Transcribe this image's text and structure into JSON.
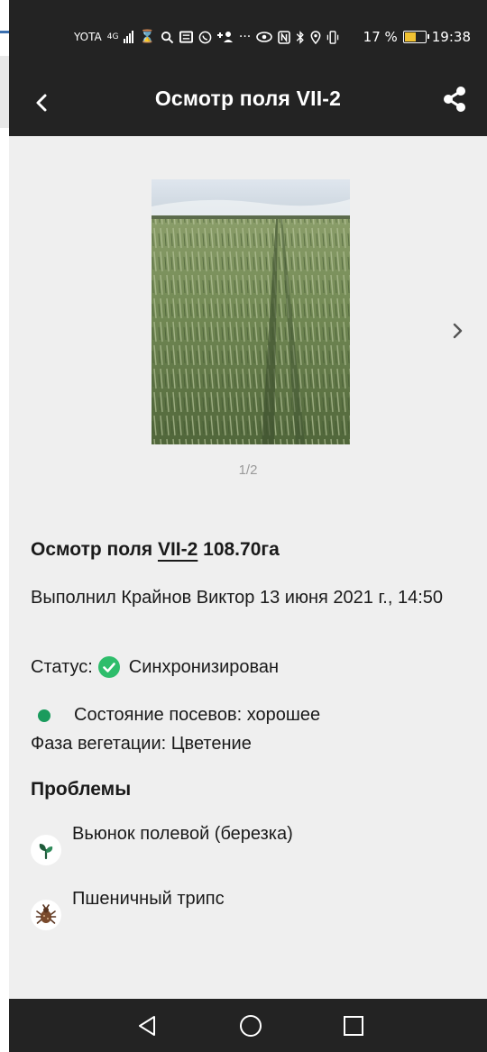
{
  "status_bar": {
    "carrier": "YOTA",
    "network": "4G",
    "battery": "17 %",
    "time": "19:38",
    "icons": [
      "signal-icon",
      "hourglass-icon",
      "search-icon",
      "message-icon",
      "viber-icon",
      "add-contact-icon",
      "more-icon",
      "eye-icon",
      "nfc-icon",
      "bluetooth-icon",
      "location-icon",
      "vibrate-icon",
      "battery-icon"
    ]
  },
  "app_bar": {
    "title": "Осмотр поля VII-2",
    "back_icon": "back-arrow-icon",
    "share_icon": "share-icon"
  },
  "gallery": {
    "pager": "1/2",
    "next_icon": "chevron-right-icon"
  },
  "inspection": {
    "title_prefix": "Осмотр поля ",
    "field_name": "VII-2",
    "area": " 108.70га",
    "performed_by": "Выполнил Крайнов Виктор 13 июня 2021 г., 14:50",
    "status_label": "Статус:",
    "status_value": "Синхронизирован",
    "status_color": "#2ebd6b",
    "crop_condition": "Состояние посевов: хорошее",
    "crop_condition_color": "#1a9b5d",
    "vegetation_phase": "Фаза вегетации: Цветение"
  },
  "problems": {
    "title": "Проблемы",
    "items": [
      {
        "name": "Вьюнок полевой (березка)",
        "icon": "sprout-icon"
      },
      {
        "name": "Пшеничный трипс",
        "icon": "bug-icon"
      }
    ]
  },
  "nav_bar": {
    "icons": [
      "nav-back-icon",
      "nav-home-icon",
      "nav-recents-icon"
    ]
  }
}
